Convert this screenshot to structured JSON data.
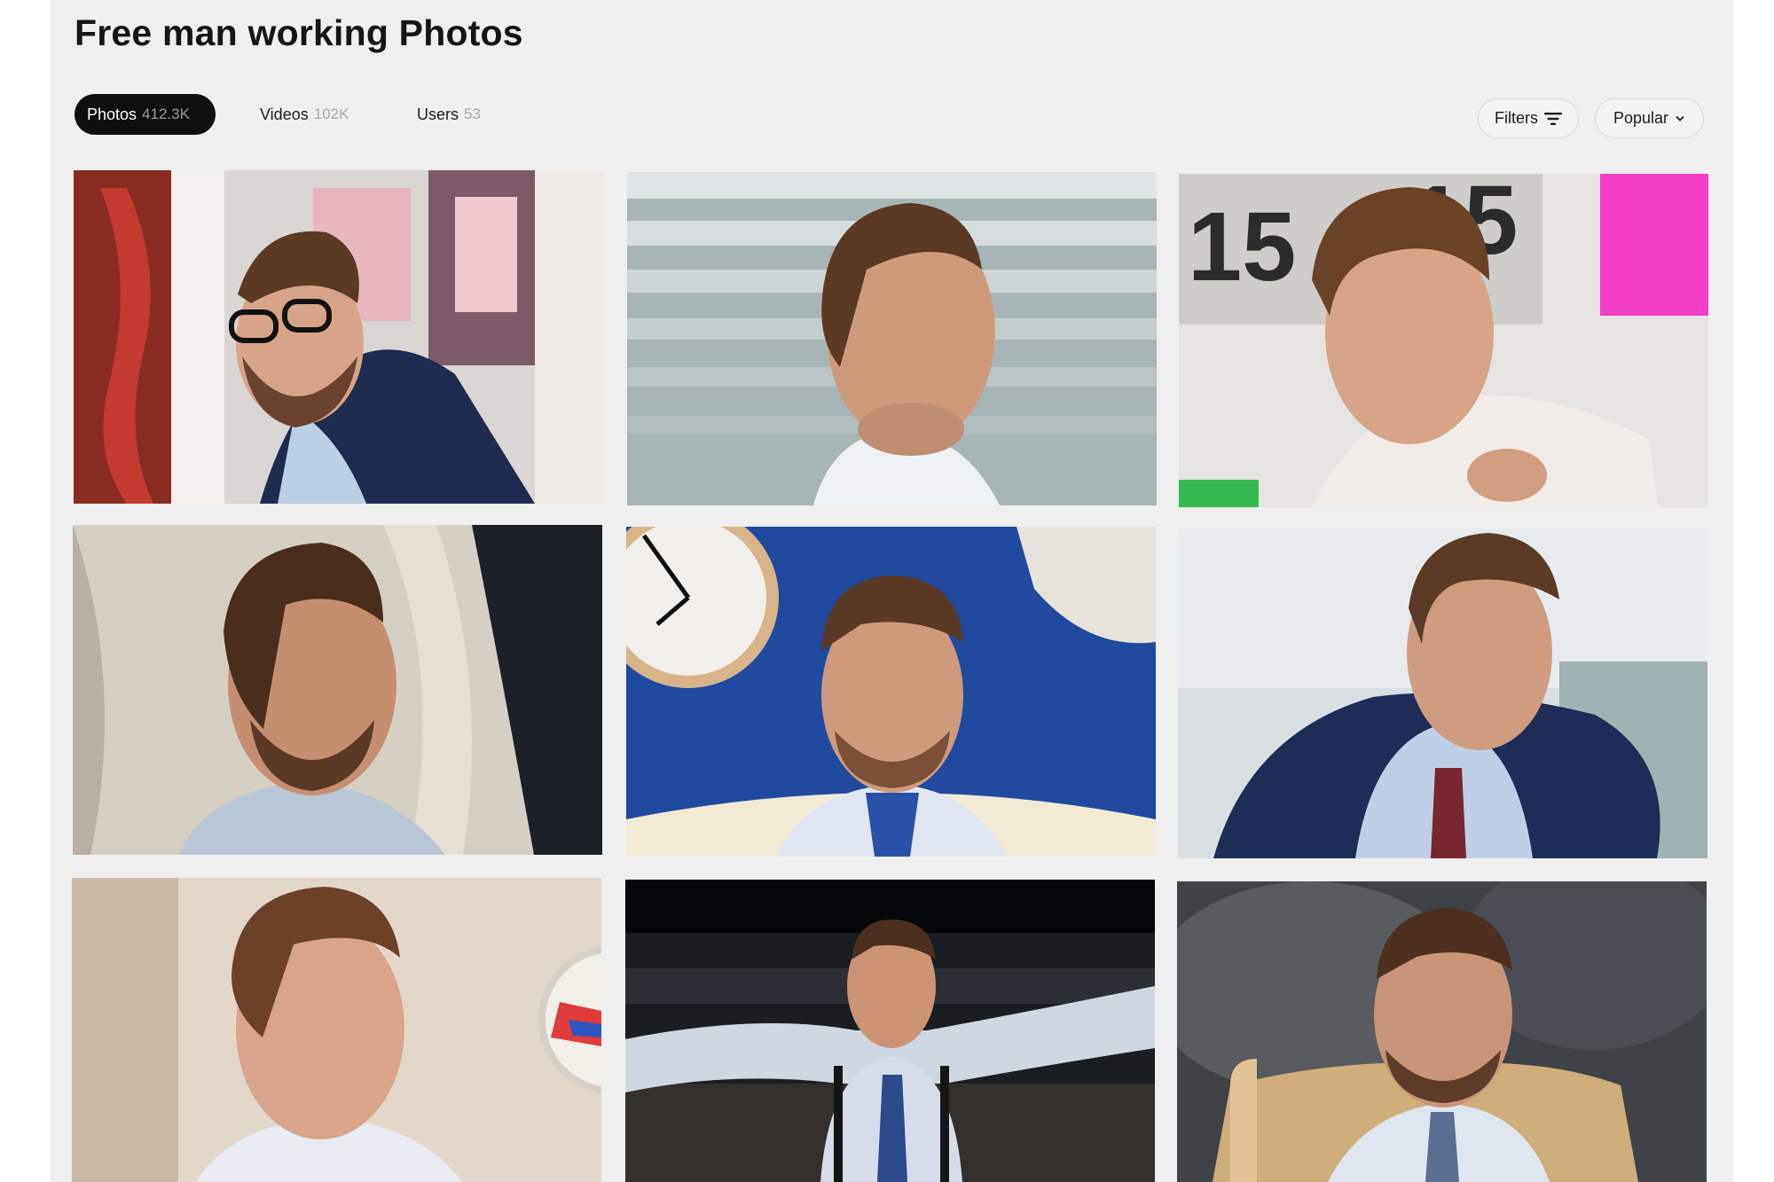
{
  "page": {
    "title": "Free man working Photos"
  },
  "tabs": [
    {
      "label": "Photos",
      "count": "412.3K",
      "active": true
    },
    {
      "label": "Videos",
      "count": "102K",
      "active": false
    },
    {
      "label": "Users",
      "count": "53",
      "active": false
    }
  ],
  "toolbar": {
    "filters_label": "Filters",
    "filters_icon": "filter-lines-icon",
    "sort_label": "Popular",
    "sort_icon": "chevron-down-icon"
  },
  "photos": [
    {
      "subject": "laughing-man-glasses-blue-blazer"
    },
    {
      "subject": "man-looking-up-blinds"
    },
    {
      "subject": "man-adjusting-collar-clock-board"
    },
    {
      "subject": "man-curtain-dark-background"
    },
    {
      "subject": "man-blue-wall-clock"
    },
    {
      "subject": "man-navy-suit-looking-down"
    },
    {
      "subject": "man-beige-wall-clock"
    },
    {
      "subject": "man-arms-outstretched-suspenders"
    },
    {
      "subject": "man-wooden-chair-dark-wall"
    }
  ],
  "colors": {
    "background": "#efefef",
    "active_tab": "#0f0f0f",
    "muted_count": "#a8a8a8",
    "title": "#151515"
  }
}
